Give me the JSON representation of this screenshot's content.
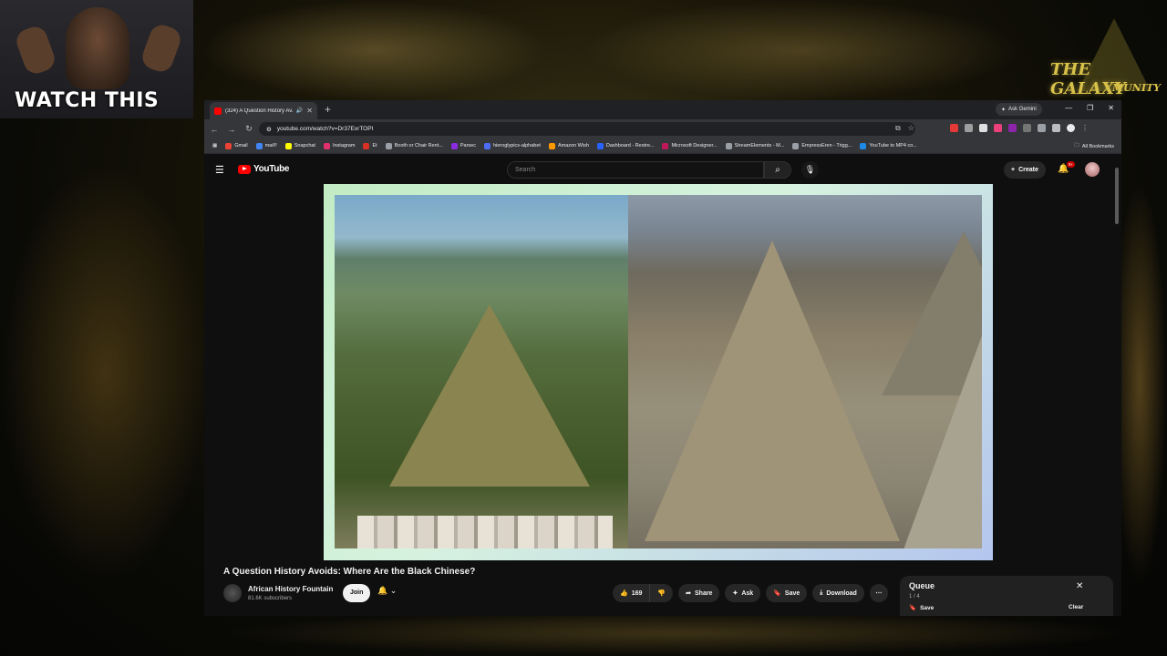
{
  "webcam": {
    "overlay_text": "WATCH THIS"
  },
  "logo": {
    "text": "THE GALAXY",
    "sub": "MUNITY"
  },
  "browser": {
    "tab_title": "(324) A Question History Av...",
    "url": "youtube.com/watch?v=Dr37ExrTOPI",
    "ask_gemini": "Ask Gemini",
    "bookmarks": [
      {
        "label": "Gmail",
        "color": "#ea4335"
      },
      {
        "label": "mail!!",
        "color": "#4285f4"
      },
      {
        "label": "Snapchat",
        "color": "#fffc00"
      },
      {
        "label": "Instagram",
        "color": "#e1306c"
      },
      {
        "label": "Et",
        "color": "#d93025"
      },
      {
        "label": "Booth or Chair Rent...",
        "color": "#9aa0a6"
      },
      {
        "label": "Parsec",
        "color": "#8a2be2"
      },
      {
        "label": "hieroglypics-alphabet",
        "color": "#4c6ef5"
      },
      {
        "label": "Amazon Wish",
        "color": "#ff9900"
      },
      {
        "label": "Dashboard - Restre...",
        "color": "#2962ff"
      },
      {
        "label": "Microsoft Designer...",
        "color": "#c2185b"
      },
      {
        "label": "StreamElements - M...",
        "color": "#9aa0a6"
      },
      {
        "label": "EmpressEren - Trigg...",
        "color": "#9aa0a6"
      },
      {
        "label": "YouTube to MP4 co...",
        "color": "#1e88e5"
      }
    ],
    "all_bookmarks": "All Bookmarks"
  },
  "youtube": {
    "logo_text": "YouTube",
    "search_placeholder": "Search",
    "create_label": "Create",
    "notif_badge": "9+",
    "video": {
      "title": "A Question History Avoids: Where Are the Black Chinese?",
      "channel": "African History Fountain",
      "subscribers": "81.6K subscribers",
      "join_label": "Join",
      "likes": "169",
      "share_label": "Share",
      "ask_label": "Ask",
      "save_label": "Save",
      "download_label": "Download"
    },
    "queue": {
      "title": "Queue",
      "count": "1 / 4",
      "save_label": "Save",
      "clear_label": "Clear"
    }
  },
  "colors": {
    "accent": "#ff0000",
    "yt_bg": "#0f0f0f",
    "chip_bg": "#272727"
  }
}
